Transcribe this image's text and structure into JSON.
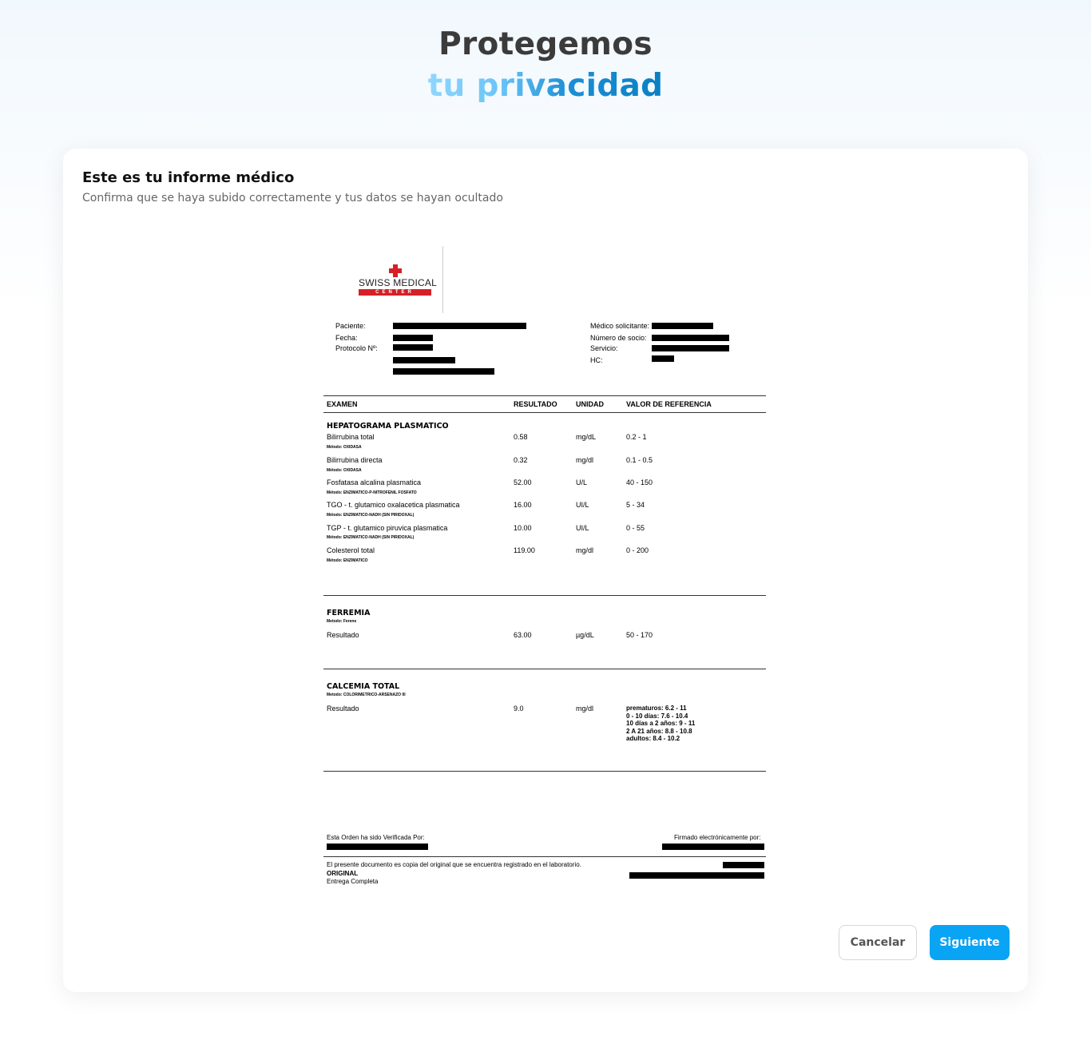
{
  "hero": {
    "line1": "Protegemos",
    "line2": "tu privacidad"
  },
  "card": {
    "title": "Este es tu informe médico",
    "subtitle": "Confirma que se haya subido correctamente y tus datos se hayan ocultado"
  },
  "document": {
    "logo": {
      "name": "SWISS MEDICAL",
      "tag": "CENTER"
    },
    "fields_left": [
      "Paciente:",
      "Fecha:",
      "Protocolo Nº:"
    ],
    "fields_right": [
      "Médico solicitante:",
      "Número de socio:",
      "Servicio:",
      "HC:"
    ],
    "headers": [
      "EXAMEN",
      "RESULTADO",
      "UNIDAD",
      "VALOR DE REFERENCIA"
    ],
    "sections": [
      {
        "title": "HEPATOGRAMA PLASMATICO",
        "rows": [
          {
            "name": "Bilirrubina total",
            "method": "Método: OXIDASA",
            "result": "0.58",
            "unit": "mg/dL",
            "ref": "0.2 - 1"
          },
          {
            "name": "Bilirrubina directa",
            "method": "Método: OXIDASA",
            "result": "0.32",
            "unit": "mg/dl",
            "ref": "0.1 - 0.5"
          },
          {
            "name": "Fosfatasa alcalina plasmatica",
            "method": "Método: ENZIMATICO-P-NITROFENIL FOSFATO",
            "result": "52.00",
            "unit": "U/L",
            "ref": "40 - 150"
          },
          {
            "name": "TGO - t. glutamico oxalacetica plasmatica",
            "method": "Método: ENZIMATICO-NADH (SIN PIRIDOXAL)",
            "result": "16.00",
            "unit": "UI/L",
            "ref": "5 - 34"
          },
          {
            "name": "TGP - t. glutamico piruvica plasmatica",
            "method": "Método: ENZIMATICO-NADH (SIN PIRIDOXAL)",
            "result": "10.00",
            "unit": "UI/L",
            "ref": "0 - 55"
          },
          {
            "name": "Colesterol total",
            "method": "Método: ENZIMATICO",
            "result": "119.00",
            "unit": "mg/dl",
            "ref": "0 - 200"
          }
        ]
      },
      {
        "title": "FERREMIA",
        "method": "Metodo: Ferene",
        "rows": [
          {
            "name": "Resultado",
            "result": "63.00",
            "unit": "µg/dL",
            "ref": "50 - 170"
          }
        ]
      },
      {
        "title": "CALCEMIA TOTAL",
        "method": "Metodo: COLORIMETRICO-ARSENAZO III",
        "rows": [
          {
            "name": "Resultado",
            "result": "9.0",
            "unit": "mg/dl",
            "ref_lines": [
              "prematuros: 6.2 - 11",
              "0 - 10 días: 7.6 - 10.4",
              "10 días a 2 años: 9 - 11",
              "2 A 21 años: 8.8 - 10.8",
              "adultos: 8.4 - 10.2"
            ]
          }
        ]
      }
    ],
    "footer": {
      "verified": "Esta Orden ha sido Verificada Por:",
      "signed": "Firmado electrónicamente por:",
      "copy_note": "El presente documento es copia del original que se encuentra registrado en el laboratorio.",
      "original": "ORIGINAL",
      "delivery": "Entrega Completa"
    }
  },
  "buttons": {
    "cancel": "Cancelar",
    "next": "Siguiente"
  },
  "colors": {
    "primary": "#0aa4f5",
    "logo_red": "#d71f26",
    "title_dark": "#3b3b3b"
  }
}
